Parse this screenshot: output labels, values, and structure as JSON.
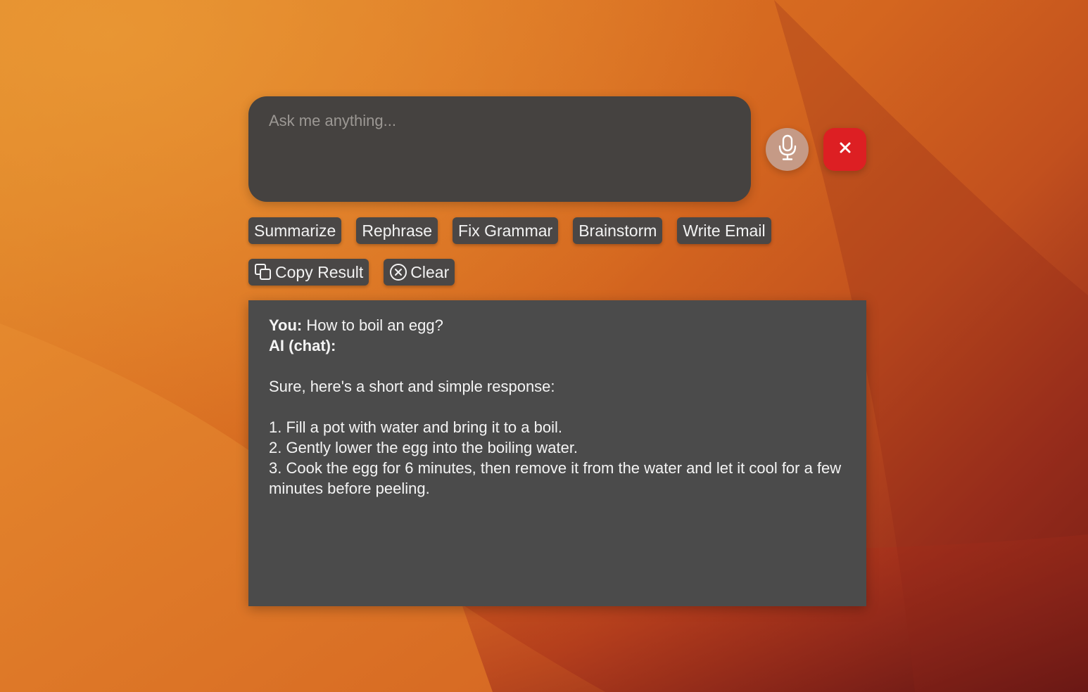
{
  "prompt": {
    "placeholder": "Ask me anything...",
    "value": ""
  },
  "controls": {
    "mic_icon": "microphone-icon",
    "close_icon": "close-icon",
    "close_color": "#dd1f23",
    "mic_color": "#c59a86"
  },
  "actions": [
    {
      "label": "Summarize"
    },
    {
      "label": "Rephrase"
    },
    {
      "label": "Fix Grammar"
    },
    {
      "label": "Brainstorm"
    },
    {
      "label": "Write Email"
    }
  ],
  "utilities": {
    "copy_label": "Copy Result",
    "copy_icon": "copy-icon",
    "clear_label": "Clear",
    "clear_icon": "circle-x-icon"
  },
  "conversation": {
    "user_prefix": "You:",
    "user_message": " How to boil an egg?",
    "ai_prefix": "AI (chat):",
    "intro": "Sure, here's a short and simple response:",
    "steps": [
      "1. Fill a pot with water and bring it to a boil.",
      "2. Gently lower the egg into the boiling water.",
      "3. Cook the egg for 6 minutes, then remove it from the water and let it cool for a few minutes before peeling."
    ]
  }
}
